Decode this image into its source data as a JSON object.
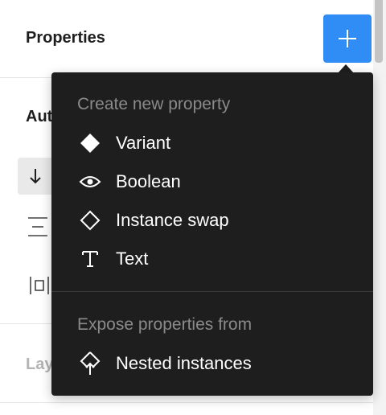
{
  "panel": {
    "properties_title": "Properties",
    "autolayout_title_visible": "Aut",
    "layer_title_visible": "Lay"
  },
  "menu": {
    "create_heading": "Create new property",
    "create_items": [
      {
        "label": "Variant",
        "icon": "diamond-filled-icon"
      },
      {
        "label": "Boolean",
        "icon": "eye-icon"
      },
      {
        "label": "Instance swap",
        "icon": "diamond-outline-icon"
      },
      {
        "label": "Text",
        "icon": "text-icon"
      }
    ],
    "expose_heading": "Expose properties from",
    "expose_items": [
      {
        "label": "Nested instances",
        "icon": "nested-instance-icon"
      }
    ]
  },
  "colors": {
    "accent": "#2f8df5",
    "menu_bg": "#1e1e1e",
    "menu_text": "#ffffff",
    "menu_heading": "#8a8a8a"
  }
}
